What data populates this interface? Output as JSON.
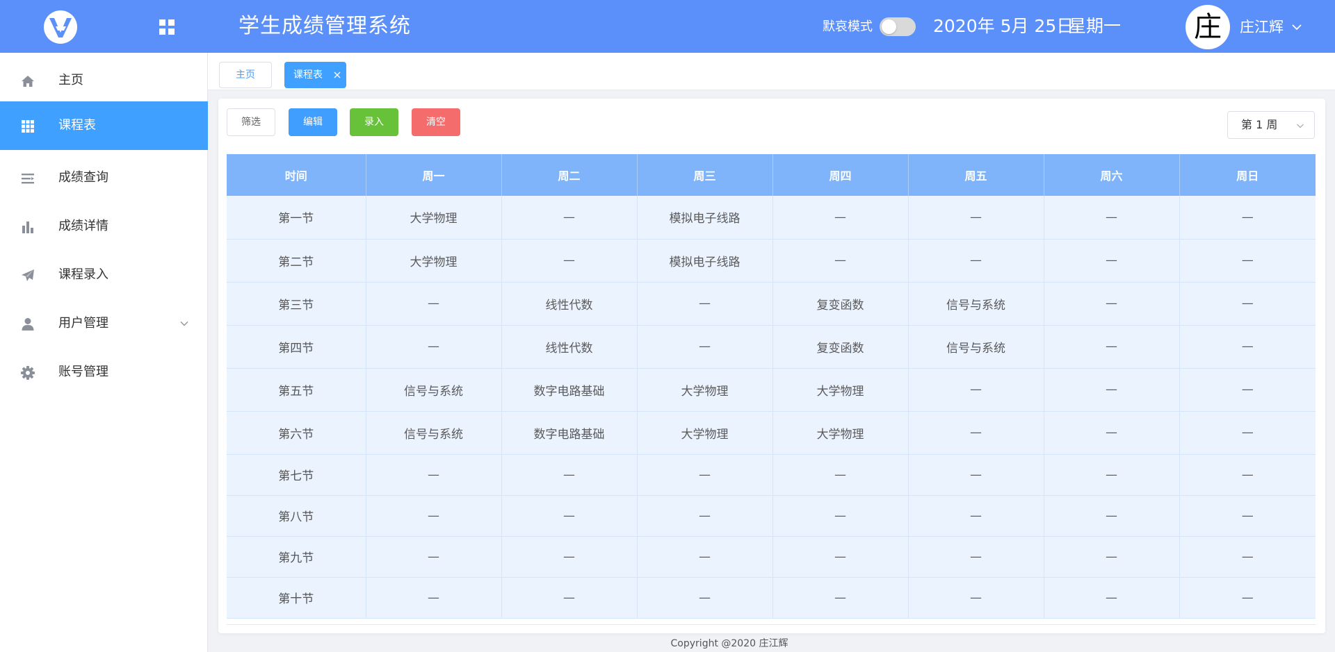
{
  "header": {
    "title": "学生成绩管理系统",
    "mode_label": "默哀模式",
    "mode_enabled": false,
    "date": "2020年 5月 25日",
    "weekday": "星期一",
    "avatar_char": "庄",
    "username": "庄江辉",
    "colors": {
      "bar": "#5b8ff9"
    }
  },
  "sidebar": {
    "items": [
      {
        "label": "主页",
        "icon": "home-icon",
        "active": false
      },
      {
        "label": "课程表",
        "icon": "grid-icon",
        "active": true
      },
      {
        "label": "成绩查询",
        "icon": "list-icon",
        "active": false
      },
      {
        "label": "成绩详情",
        "icon": "bar-chart-icon",
        "active": false
      },
      {
        "label": "课程录入",
        "icon": "send-icon",
        "active": false
      },
      {
        "label": "用户管理",
        "icon": "user-icon",
        "active": false,
        "expandable": true
      },
      {
        "label": "账号管理",
        "icon": "gear-icon",
        "active": false
      }
    ],
    "active_color": "#40a0ff"
  },
  "tabs": [
    {
      "label": "主页",
      "active": false
    },
    {
      "label": "课程表",
      "active": true,
      "closable": true
    }
  ],
  "toolbar": {
    "filter_label": "筛选",
    "edit_label": "编辑",
    "enter_label": "录入",
    "clear_label": "清空",
    "week_selected": "第 1 周"
  },
  "timetable": {
    "headers": [
      "时间",
      "周一",
      "周二",
      "周三",
      "周四",
      "周五",
      "周六",
      "周日"
    ],
    "rows": [
      [
        "第一节",
        "大学物理",
        "—",
        "模拟电子线路",
        "—",
        "—",
        "—",
        "—"
      ],
      [
        "第二节",
        "大学物理",
        "—",
        "模拟电子线路",
        "—",
        "—",
        "—",
        "—"
      ],
      [
        "第三节",
        "—",
        "线性代数",
        "—",
        "复变函数",
        "信号与系统",
        "—",
        "—"
      ],
      [
        "第四节",
        "—",
        "线性代数",
        "—",
        "复变函数",
        "信号与系统",
        "—",
        "—"
      ],
      [
        "第五节",
        "信号与系统",
        "数字电路基础",
        "大学物理",
        "大学物理",
        "—",
        "—",
        "—"
      ],
      [
        "第六节",
        "信号与系统",
        "数字电路基础",
        "大学物理",
        "大学物理",
        "—",
        "—",
        "—"
      ],
      [
        "第七节",
        "—",
        "—",
        "—",
        "—",
        "—",
        "—",
        "—"
      ],
      [
        "第八节",
        "—",
        "—",
        "—",
        "—",
        "—",
        "—",
        "—"
      ],
      [
        "第九节",
        "—",
        "—",
        "—",
        "—",
        "—",
        "—",
        "—"
      ],
      [
        "第十节",
        "—",
        "—",
        "—",
        "—",
        "—",
        "—",
        "—"
      ]
    ]
  },
  "footer": {
    "copyright": "Copyright @2020 庄江辉"
  }
}
